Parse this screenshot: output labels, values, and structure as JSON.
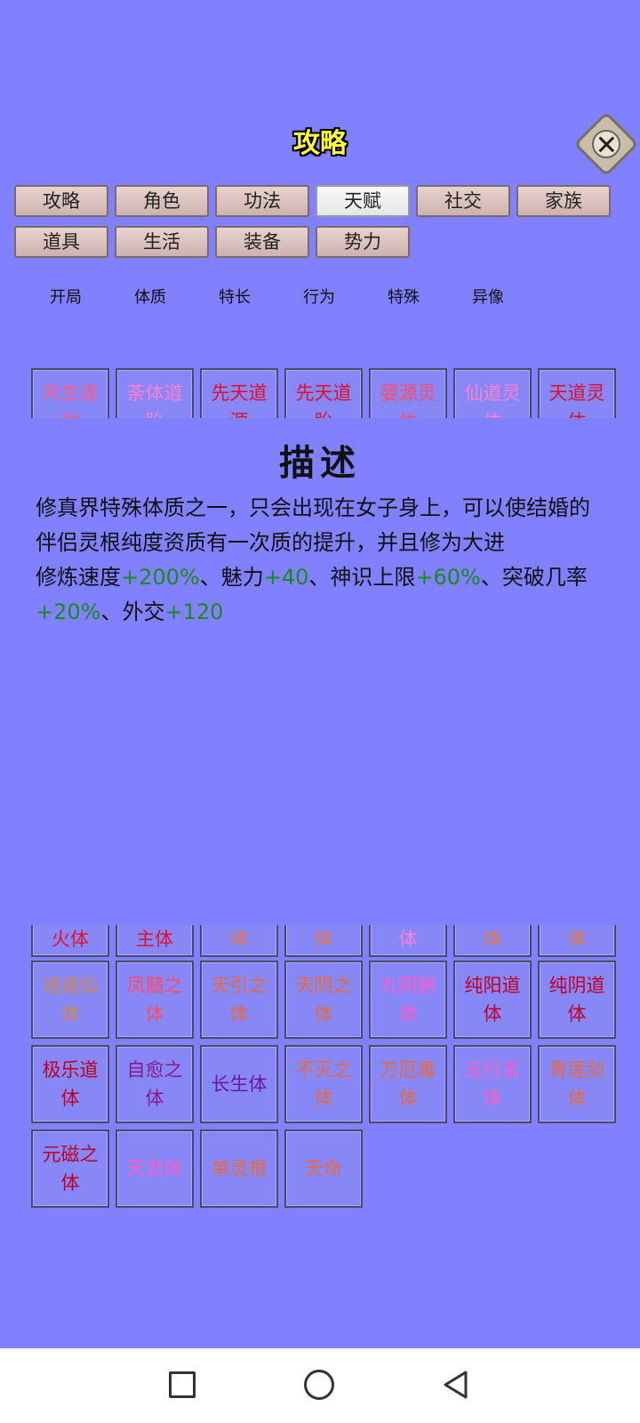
{
  "title": "攻略",
  "tabs_row1": [
    "攻略",
    "角色",
    "功法",
    "天赋",
    "社交",
    "家族"
  ],
  "tabs_row2": [
    "道具",
    "生活",
    "装备",
    "势力"
  ],
  "active_tab": "天赋",
  "subtabs": [
    "开局",
    "体质",
    "特长",
    "行为",
    "特殊",
    "异像"
  ],
  "top_strip": [
    {
      "l1": "天生道",
      "l2": "种",
      "color": "#ff5c8a"
    },
    {
      "l1": "荼体道",
      "l2": "胎",
      "color": "#ff7fd0"
    },
    {
      "l1": "先天道",
      "l2": "源",
      "color": "#e0102a"
    },
    {
      "l1": "先天道",
      "l2": "胎",
      "color": "#e0102a"
    },
    {
      "l1": "婴源灵",
      "l2": "体",
      "color": "#ff4a6a"
    },
    {
      "l1": "仙道灵",
      "l2": "体",
      "color": "#ff7fd0"
    },
    {
      "l1": "天道灵",
      "l2": "体",
      "color": "#e0102a"
    }
  ],
  "description": {
    "heading": "描述",
    "text": "修真界特殊体质之一，只会出现在女子身上，可以使结婚的伴侣灵根纯度资质有一次质的提升，并且修为大进",
    "stats": [
      {
        "label": "修炼速度",
        "value": "+200%",
        "sep": "、"
      },
      {
        "label": "魅力",
        "value": "+40",
        "sep": "、"
      },
      {
        "label": "神识上限",
        "value": "+60%",
        "sep": "、"
      },
      {
        "label": "突破几率",
        "value": "+20%",
        "sep": "、"
      },
      {
        "label": "外交",
        "value": "+120",
        "sep": ""
      }
    ]
  },
  "mid_strip": [
    {
      "l2": "火体",
      "color": "#e0102a"
    },
    {
      "l2": "主体",
      "color": "#e0102a"
    },
    {
      "l2": "体",
      "color": "#e87a4a"
    },
    {
      "l2": "体",
      "color": "#e87a4a"
    },
    {
      "l2": "体",
      "color": "#ff7fd0"
    },
    {
      "l2": "体",
      "color": "#e87a4a"
    },
    {
      "l2": "体",
      "color": "#e87a4a"
    }
  ],
  "grid": [
    [
      {
        "l1": "逍遥仙",
        "l2": "体",
        "color": "#d08a4a"
      },
      {
        "l1": "凤髓之",
        "l2": "体",
        "color": "#ff4a6a"
      },
      {
        "l1": "天引之",
        "l2": "体",
        "color": "#e86a3a"
      },
      {
        "l1": "天阴之",
        "l2": "体",
        "color": "#e86a3a"
      },
      {
        "l1": "九阴魅",
        "l2": "体",
        "color": "#ff5cc8"
      },
      {
        "l1": "纯阳道",
        "l2": "体",
        "color": "#c00020"
      },
      {
        "l1": "纯阴道",
        "l2": "体",
        "color": "#c00020"
      }
    ],
    [
      {
        "l1": "极乐道",
        "l2": "体",
        "color": "#c00020"
      },
      {
        "l1": "自愈之",
        "l2": "体",
        "color": "#8a1a8a"
      },
      {
        "l1": "长生体",
        "l2": "",
        "color": "#6a1a9a"
      },
      {
        "l1": "不灭之",
        "l2": "体",
        "color": "#e86a3a"
      },
      {
        "l1": "万厄毒",
        "l2": "体",
        "color": "#e86a3a"
      },
      {
        "l1": "五行玄",
        "l2": "体",
        "color": "#ff5cc8"
      },
      {
        "l1": "青莲剑",
        "l2": "体",
        "color": "#e86a3a"
      }
    ],
    [
      {
        "l1": "元磁之",
        "l2": "体",
        "color": "#c00020"
      },
      {
        "l1": "天灵体",
        "l2": "",
        "color": "#ff5cc8"
      },
      {
        "l1": "单灵根",
        "l2": "",
        "color": "#e86a3a"
      },
      {
        "l1": "天命",
        "l2": "",
        "color": "#e86a3a"
      }
    ]
  ]
}
